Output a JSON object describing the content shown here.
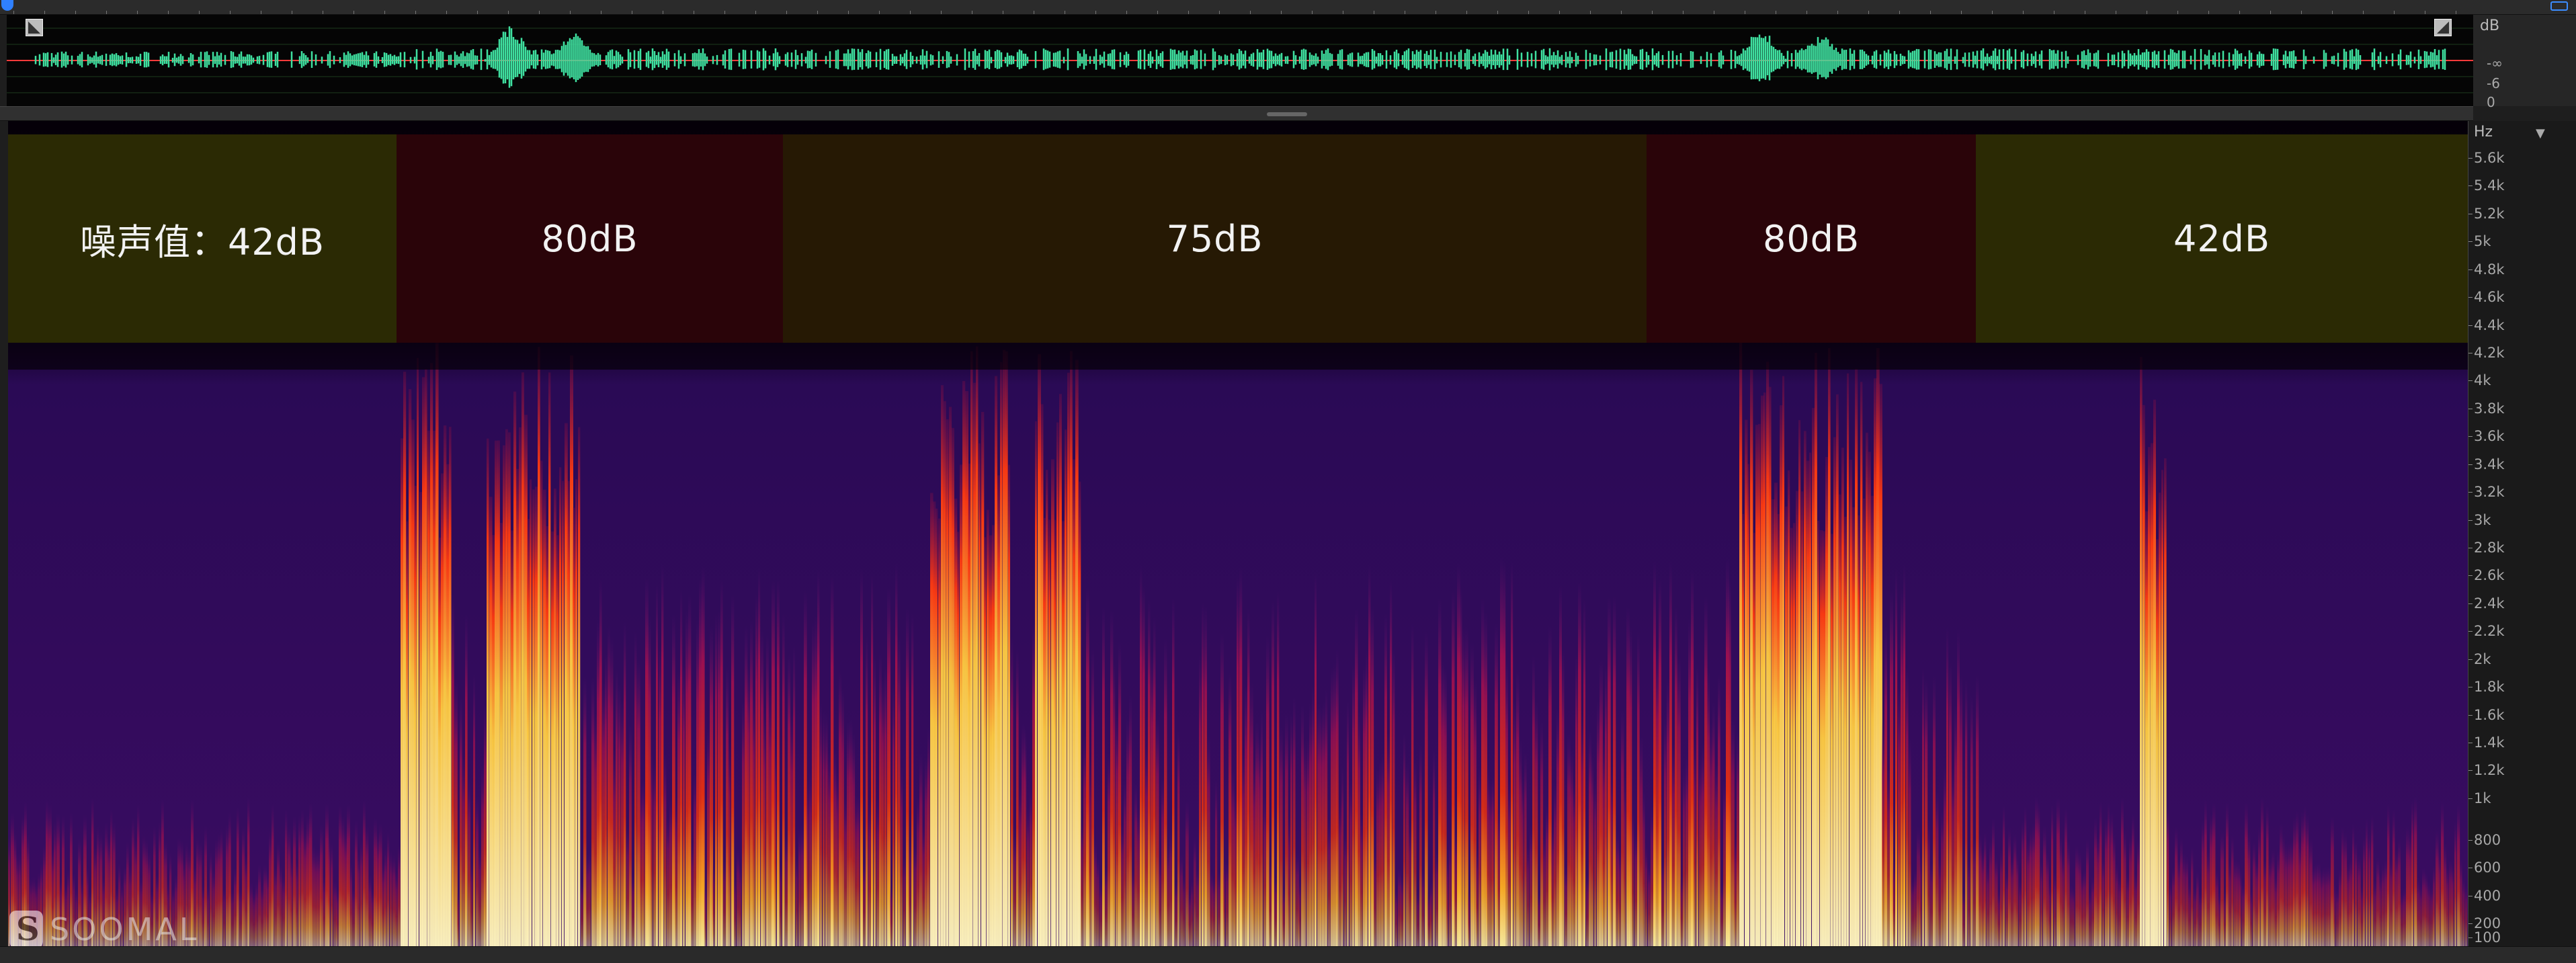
{
  "colors": {
    "band_quiet": "#2b2a04",
    "band_loud": "#2a0409",
    "band_mid": "#261904",
    "waveform": "#3fe0a0",
    "center_line": "#ff3a3a"
  },
  "overview": {
    "db_scale_label": "dB",
    "db_ticks": [
      "-∞",
      "-6",
      "0"
    ]
  },
  "noise_bands": [
    {
      "label": "噪声值：42dB",
      "level_db": 42,
      "start": 0.0,
      "end": 0.158,
      "kind": "quiet"
    },
    {
      "label": "80dB",
      "level_db": 80,
      "start": 0.158,
      "end": 0.315,
      "kind": "loud"
    },
    {
      "label": "75dB",
      "level_db": 75,
      "start": 0.315,
      "end": 0.666,
      "kind": "mid"
    },
    {
      "label": "80dB",
      "level_db": 80,
      "start": 0.666,
      "end": 0.8,
      "kind": "loud"
    },
    {
      "label": "42dB",
      "level_db": 42,
      "start": 0.8,
      "end": 1.0,
      "kind": "quiet"
    }
  ],
  "frequency_axis": {
    "unit_label": "Hz",
    "ticks": [
      {
        "label": "5.6k",
        "hz": 5600
      },
      {
        "label": "5.4k",
        "hz": 5400
      },
      {
        "label": "5.2k",
        "hz": 5200
      },
      {
        "label": "5k",
        "hz": 5000
      },
      {
        "label": "4.8k",
        "hz": 4800
      },
      {
        "label": "4.6k",
        "hz": 4600
      },
      {
        "label": "4.4k",
        "hz": 4400
      },
      {
        "label": "4.2k",
        "hz": 4200
      },
      {
        "label": "4k",
        "hz": 4000
      },
      {
        "label": "3.8k",
        "hz": 3800
      },
      {
        "label": "3.6k",
        "hz": 3600
      },
      {
        "label": "3.4k",
        "hz": 3400
      },
      {
        "label": "3.2k",
        "hz": 3200
      },
      {
        "label": "3k",
        "hz": 3000
      },
      {
        "label": "2.8k",
        "hz": 2800
      },
      {
        "label": "2.6k",
        "hz": 2600
      },
      {
        "label": "2.4k",
        "hz": 2400
      },
      {
        "label": "2.2k",
        "hz": 2200
      },
      {
        "label": "2k",
        "hz": 2000
      },
      {
        "label": "1.8k",
        "hz": 1800
      },
      {
        "label": "1.6k",
        "hz": 1600
      },
      {
        "label": "1.4k",
        "hz": 1400
      },
      {
        "label": "1.2k",
        "hz": 1200
      },
      {
        "label": "1k",
        "hz": 1000
      },
      {
        "label": "800",
        "hz": 800
      },
      {
        "label": "600",
        "hz": 600
      },
      {
        "label": "400",
        "hz": 400
      },
      {
        "label": "200",
        "hz": 200
      },
      {
        "label": "100",
        "hz": 100
      }
    ]
  },
  "watermark": {
    "text": "SOOMAL"
  },
  "icons": {
    "overview_left": "zoom-corner-icon",
    "overview_right": "zoom-corner-icon",
    "top_right": "view-toggle-icon"
  }
}
